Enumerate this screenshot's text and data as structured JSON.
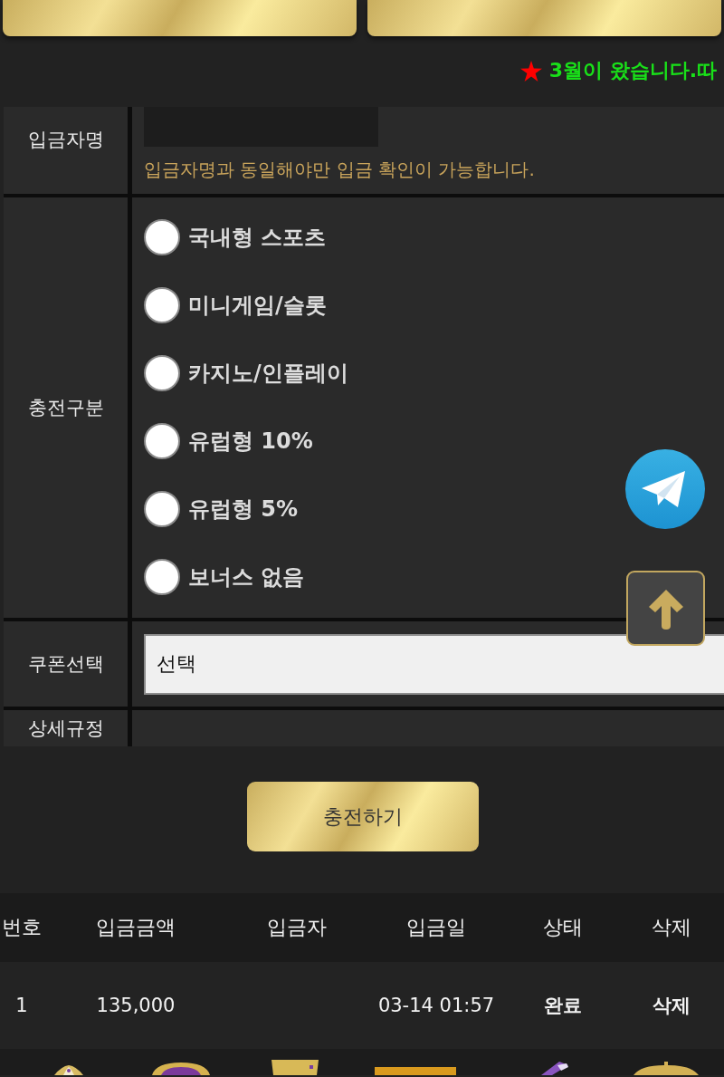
{
  "top_buttons": [
    {
      "kind": "gold"
    },
    {
      "kind": "gold"
    }
  ],
  "notice": {
    "text": "3월이 왔습니다.따"
  },
  "form": {
    "depositor": {
      "label": "입금자명",
      "hint": "입금자명과 동일해야만 입금 확인이 가능합니다."
    },
    "charge_type": {
      "label": "충전구분",
      "options": [
        {
          "label": "국내형 스포츠",
          "selected": false
        },
        {
          "label": "미니게임/슬롯",
          "selected": false
        },
        {
          "label": "카지노/인플레이",
          "selected": false
        },
        {
          "label": "유럽형 10%",
          "selected": false
        },
        {
          "label": "유럽형 5%",
          "selected": false
        },
        {
          "label": "보너스 없음",
          "selected": false
        }
      ]
    },
    "coupon": {
      "label": "쿠폰선택",
      "value": "선택"
    },
    "rules": {
      "label": "상세규정"
    }
  },
  "submit_button": "충전하기",
  "history": {
    "columns": [
      "번호",
      "입금금액",
      "입금자",
      "입금일",
      "상태",
      "삭제"
    ],
    "rows": [
      {
        "number": "1",
        "amount": "135,000",
        "date": "03-14 01:57",
        "status": "완료",
        "action": "삭제"
      }
    ]
  }
}
